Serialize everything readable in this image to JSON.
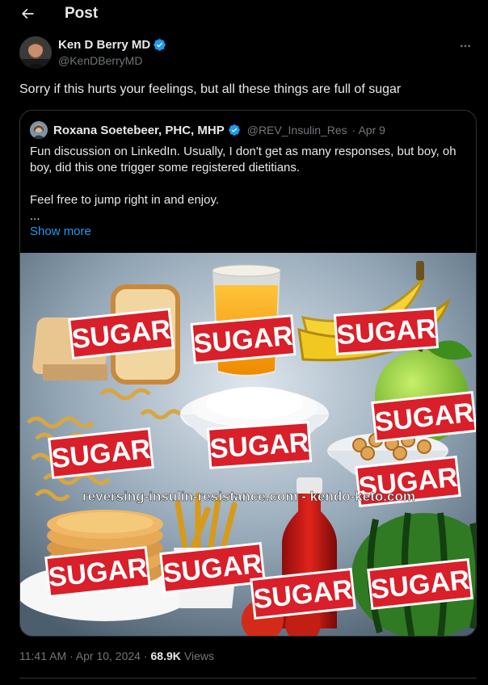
{
  "header": {
    "title": "Post",
    "back_icon": "arrow-left-icon"
  },
  "post": {
    "author_name": "Ken D Berry MD",
    "author_handle": "@KenDBerryMD",
    "verified_icon": "verified-badge-icon",
    "more_icon": "more-horizontal-icon",
    "text": "Sorry if this hurts your feelings, but all these things are full of sugar",
    "timestamp": "11:41 AM · Apr 10, 2024 ·",
    "views_count": "68.9K",
    "views_label": "Views"
  },
  "quote": {
    "author_name": "Roxana Soetebeer, PHC, MHP",
    "author_handle": "@REV_Insulin_Res",
    "date": "· Apr 9",
    "line1": "Fun discussion on LinkedIn. Usually, I don't get as many responses, but boy, oh",
    "line2": "boy, did this one trigger some registered dietitians.",
    "line3": "Feel free to jump right in and enjoy.",
    "line4": "...",
    "show_more": "Show more",
    "image": {
      "sugar_label": "SUGAR",
      "watermark": "reversing-insulin-resistance.com - kendo-keto.com",
      "foods": [
        "bread",
        "orange juice",
        "bananas",
        "pasta",
        "rice",
        "apple",
        "cereal",
        "pancakes",
        "french fries",
        "ketchup",
        "tomatoes",
        "watermelon"
      ]
    }
  },
  "colors": {
    "background": "#000000",
    "text": "#e7e9ea",
    "secondary": "#71767b",
    "accent": "#1d9bf0",
    "border": "#2f3336",
    "sugar_red": "#d81f2a"
  }
}
